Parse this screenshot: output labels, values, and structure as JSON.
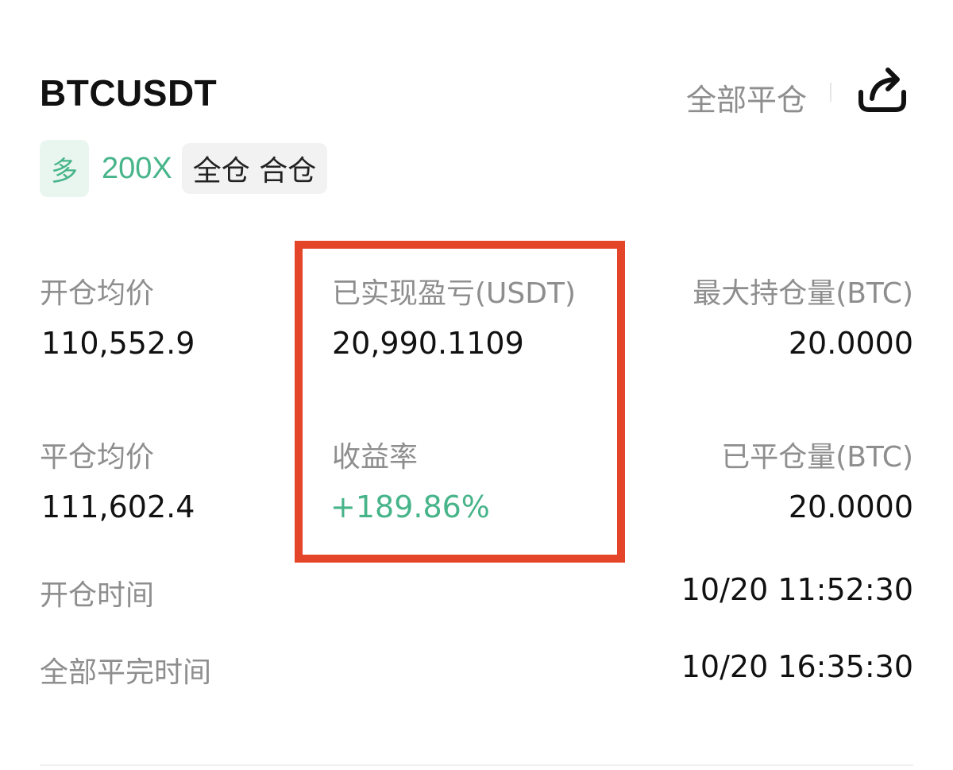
{
  "header": {
    "symbol": "BTCUSDT",
    "close_all_label": "全部平仓",
    "share_icon": "share-icon"
  },
  "tags": {
    "side": "多",
    "leverage": "200X",
    "margin_mode": "全仓 合仓"
  },
  "stats": {
    "open_avg_price": {
      "label": "开仓均价",
      "value": "110,552.9"
    },
    "realized_pnl": {
      "label": "已实现盈亏(USDT)",
      "value": "20,990.1109"
    },
    "max_position": {
      "label": "最大持仓量(BTC)",
      "value": "20.0000"
    },
    "close_avg_price": {
      "label": "平仓均价",
      "value": "111,602.4"
    },
    "roi": {
      "label": "收益率",
      "value": "+189.86%"
    },
    "closed_volume": {
      "label": "已平仓量(BTC)",
      "value": "20.0000"
    },
    "open_time": {
      "label": "开仓时间",
      "value": "10/20 11:52:30"
    },
    "close_time": {
      "label": "全部平完时间",
      "value": "10/20 16:35:30"
    }
  },
  "colors": {
    "accent_green": "#47b48a",
    "highlight_red": "#e44528",
    "label_gray": "#8e8e8e"
  }
}
